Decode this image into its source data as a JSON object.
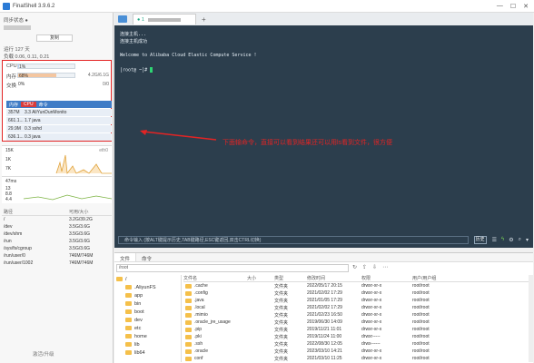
{
  "window": {
    "title": "FinalShell 3.9.6.2",
    "controls": [
      "—",
      "☐",
      "✕"
    ]
  },
  "sidebar": {
    "sync_label": "同步状态 ●",
    "copy_button": "复制",
    "uptime": "运行 127 天",
    "load": "负载 0.06, 0.11, 0.21",
    "cpu": {
      "label": "CPU",
      "percent": 1,
      "percent_text": "1%"
    },
    "mem": {
      "label": "内存",
      "percent": 68,
      "percent_text": "68%",
      "detail": "4.2G/6.1G"
    },
    "swap": {
      "label": "交换",
      "percent": 0,
      "percent_text": "0%",
      "detail": "0/0"
    },
    "proc_tabs": [
      "内存",
      "CPU",
      "命令"
    ],
    "processes": [
      {
        "mem": "357M",
        "cmd": "3.3 AliYunDunMonito"
      },
      {
        "mem": "661.1...",
        "cmd": "1.7 java"
      },
      {
        "mem": "29.9M",
        "cmd": "0.3 sshd"
      },
      {
        "mem": "636.1...",
        "cmd": "0.3 java"
      }
    ],
    "net": {
      "ticks": [
        "15K",
        "1K",
        "7K"
      ],
      "iface": "eth0"
    },
    "io": {
      "ticks": [
        "13",
        "8.8",
        "4.4"
      ],
      "unit": "ms",
      "label": "47ms"
    },
    "disk_headers": [
      "路径",
      "可用/大小"
    ],
    "disks": [
      {
        "path": "/",
        "size": "3.2G/39.2G"
      },
      {
        "path": "/dev",
        "size": "3.5G/3.6G"
      },
      {
        "path": "/dev/shm",
        "size": "3.5G/3.6G"
      },
      {
        "path": "/run",
        "size": "3.5G/3.6G"
      },
      {
        "path": "/sys/fs/cgroup",
        "size": "3.5G/3.6G"
      },
      {
        "path": "/run/user/0",
        "size": "746M/746M"
      },
      {
        "path": "/run/user/1002",
        "size": "746M/746M"
      }
    ],
    "bottom": "激活/升级"
  },
  "terminal": {
    "tab_label": "1",
    "lines": [
      "连接主机...",
      "连接主机成功",
      "Welcome to Alibaba Cloud Elastic Compute Service !",
      "[root@ ~]# "
    ],
    "command_placeholder": "命令输入 (按ALT键提示历史,TAB键路径,ESC键返回,双击CTRL切换)",
    "history_button": "历史",
    "tool_icons": [
      "history-icon",
      "flash-icon",
      "settings-icon",
      "search-icon",
      "expand-icon"
    ]
  },
  "annotation": {
    "text": "下面输命令，直接可以看到结果还可以用ls看到文件，很方便",
    "color": "#e32424"
  },
  "filemgr": {
    "tabs": [
      "文件",
      "命令"
    ],
    "path": "/root",
    "tree": [
      ".AliyunFS",
      "app",
      "bin",
      "boot",
      "dev",
      "etc",
      "home",
      "lib",
      "lib64"
    ],
    "columns": [
      "文件名",
      "大小",
      "类型",
      "修改时间",
      "权限",
      "用户/用户组"
    ],
    "files": [
      {
        "name": ".cache",
        "size": "",
        "type": "文件夹",
        "mtime": "2022/05/17 20:15",
        "perm": "drwxr-xr-x",
        "owner": "root/root"
      },
      {
        "name": ".config",
        "size": "",
        "type": "文件夹",
        "mtime": "2021/02/02 17:29",
        "perm": "drwxr-xr-x",
        "owner": "root/root"
      },
      {
        "name": ".java",
        "size": "",
        "type": "文件夹",
        "mtime": "2021/01/05 17:29",
        "perm": "drwxr-xr-x",
        "owner": "root/root"
      },
      {
        "name": ".local",
        "size": "",
        "type": "文件夹",
        "mtime": "2021/02/02 17:29",
        "perm": "drwxr-xr-x",
        "owner": "root/root"
      },
      {
        "name": ".mimio",
        "size": "",
        "type": "文件夹",
        "mtime": "2021/02/23 16:50",
        "perm": "drwxr-xr-x",
        "owner": "root/root"
      },
      {
        "name": ".oracle_jre_usage",
        "size": "",
        "type": "文件夹",
        "mtime": "2019/06/30 14:09",
        "perm": "drwxr-xr-x",
        "owner": "root/root"
      },
      {
        "name": ".pip",
        "size": "",
        "type": "文件夹",
        "mtime": "2019/11/21 11:01",
        "perm": "drwxr-xr-x",
        "owner": "root/root"
      },
      {
        "name": ".pki",
        "size": "",
        "type": "文件夹",
        "mtime": "2019/11/24 11:00",
        "perm": "drwxr-----",
        "owner": "root/root"
      },
      {
        "name": ".ssh",
        "size": "",
        "type": "文件夹",
        "mtime": "2022/08/30 12:05",
        "perm": "drwx------",
        "owner": "root/root"
      },
      {
        "name": ".oracle",
        "size": "",
        "type": "文件夹",
        "mtime": "2023/03/10 14:21",
        "perm": "drwxr-xr-x",
        "owner": "root/root"
      },
      {
        "name": "conf",
        "size": "",
        "type": "文件夹",
        "mtime": "2021/03/10 11:25",
        "perm": "drwxr-xr-x",
        "owner": "root/root"
      }
    ],
    "tool_icons": [
      "refresh-icon",
      "upload-icon",
      "download-icon",
      "more-icon"
    ]
  },
  "colors": {
    "accent": "#3f7cc6",
    "terminal_bg": "#2c3e4d",
    "highlight": "#e32424",
    "cpu_tab": "#d93c3c",
    "mem_fill": "#f4c6a0",
    "cpu_fill": "#b7d5f2"
  }
}
